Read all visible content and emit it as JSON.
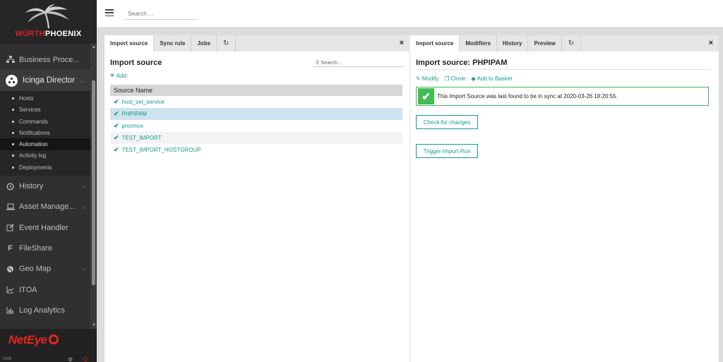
{
  "sidebar": {
    "brand": {
      "part1": "WÜRTH",
      "part2": "PHOENIX"
    },
    "items": [
      {
        "label": "Business Proce...",
        "icon": "sitemap-icon",
        "chevron": ""
      },
      {
        "label": "Icinga Director",
        "icon": "director-icon",
        "chevron": "⌄"
      }
    ],
    "director_sub": [
      {
        "label": "Hosts"
      },
      {
        "label": "Services"
      },
      {
        "label": "Commands"
      },
      {
        "label": "Notifications"
      },
      {
        "label": "Automation"
      },
      {
        "label": "Activity log"
      },
      {
        "label": "Deployments"
      }
    ],
    "items_after": [
      {
        "label": "History",
        "icon": "history-icon",
        "chevron": "‹"
      },
      {
        "label": "Asset Manage...",
        "icon": "laptop-icon",
        "chevron": "‹"
      },
      {
        "label": "Event Handler",
        "icon": "edit-icon",
        "chevron": ""
      },
      {
        "label": "FileShare",
        "icon": "f-icon",
        "chevron": ""
      },
      {
        "label": "Geo Map",
        "icon": "globe-icon",
        "chevron": "‹"
      },
      {
        "label": "ITOA",
        "icon": "chart-icon",
        "chevron": ""
      },
      {
        "label": "Log Analytics",
        "icon": "bar-chart-icon",
        "chevron": ""
      }
    ],
    "footer_logo": "NetEye",
    "user": "root"
  },
  "topbar": {
    "search_placeholder": "Search ..."
  },
  "left_panel": {
    "tabs": [
      "Import source",
      "Sync rule",
      "Jobs"
    ],
    "refresh_glyph": "↻",
    "close_glyph": "×",
    "title": "Import source",
    "search_placeholder": "Search...",
    "add_label": "Add",
    "column_header": "Source Name",
    "rows": [
      {
        "name": "host_set_service"
      },
      {
        "name": "PHPIPAM"
      },
      {
        "name": "proxmox"
      },
      {
        "name": "TEST_IMPORT"
      },
      {
        "name": "TEST_IMPORT_HOSTGROUP"
      }
    ]
  },
  "right_panel": {
    "tabs": [
      "Import source",
      "Modifiers",
      "History",
      "Preview"
    ],
    "refresh_glyph": "↻",
    "close_glyph": "×",
    "title": "Import source: PHPIPAM",
    "actions": [
      "Modify",
      "Clone",
      "Add to Basket"
    ],
    "sync_message": "This Import Source was last found to be in sync at 2020-03-26 18:20:55.",
    "check_button": "Check for changes",
    "trigger_button": "Trigger Import Run"
  },
  "colors": {
    "accent": "#1a9a8b",
    "success": "#44bb55",
    "sidebar_bg": "#303030",
    "brand_red": "#e52521",
    "selected_row": "#cde3ee"
  }
}
